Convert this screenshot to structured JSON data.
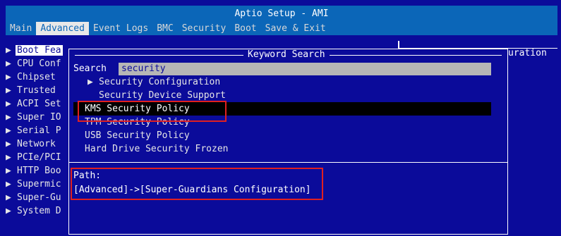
{
  "header": {
    "title": "Aptio Setup - AMI",
    "menu": [
      {
        "label": "Main",
        "active": false
      },
      {
        "label": "Advanced",
        "active": true
      },
      {
        "label": "Event Logs",
        "active": false
      },
      {
        "label": "BMC",
        "active": false
      },
      {
        "label": "Security",
        "active": false
      },
      {
        "label": "Boot",
        "active": false
      },
      {
        "label": "Save & Exit",
        "active": false
      }
    ]
  },
  "left_menu": {
    "items": [
      {
        "label": "Boot Fea"
      },
      {
        "label": "CPU Conf"
      },
      {
        "label": "Chipset"
      },
      {
        "label": "Trusted"
      },
      {
        "label": "ACPI Set"
      },
      {
        "label": "Super IO"
      },
      {
        "label": "Serial P"
      },
      {
        "label": "Network"
      },
      {
        "label": "PCIe/PCI"
      },
      {
        "label": "HTTP Boo"
      },
      {
        "label": "Supermic"
      },
      {
        "label": "Super-Gu"
      },
      {
        "label": "System D"
      }
    ]
  },
  "right_help": {
    "text": "uration"
  },
  "dialog": {
    "title": "Keyword Search",
    "search_label": "Search",
    "search_value": "security",
    "results": [
      {
        "label": "Security Configuration",
        "submenu": true,
        "indent": 0
      },
      {
        "label": "Security Device Support",
        "submenu": false,
        "indent": 1
      },
      {
        "label": "KMS Security Policy",
        "submenu": false,
        "indent": 0,
        "highlight": true
      },
      {
        "label": "TPM Security Policy",
        "submenu": false,
        "indent": 0
      },
      {
        "label": "USB Security Policy",
        "submenu": false,
        "indent": 0
      },
      {
        "label": "Hard Drive Security Frozen",
        "submenu": false,
        "indent": 0
      }
    ],
    "path_label": "Path:",
    "path_value": "[Advanced]->[Super-Guardians Configuration]"
  },
  "colors": {
    "background": "#0b0b9a",
    "header_bar": "#0b66b8",
    "highlight_row": "#000000",
    "annotation_red": "#e02020",
    "search_field": "#b6b6b6"
  }
}
